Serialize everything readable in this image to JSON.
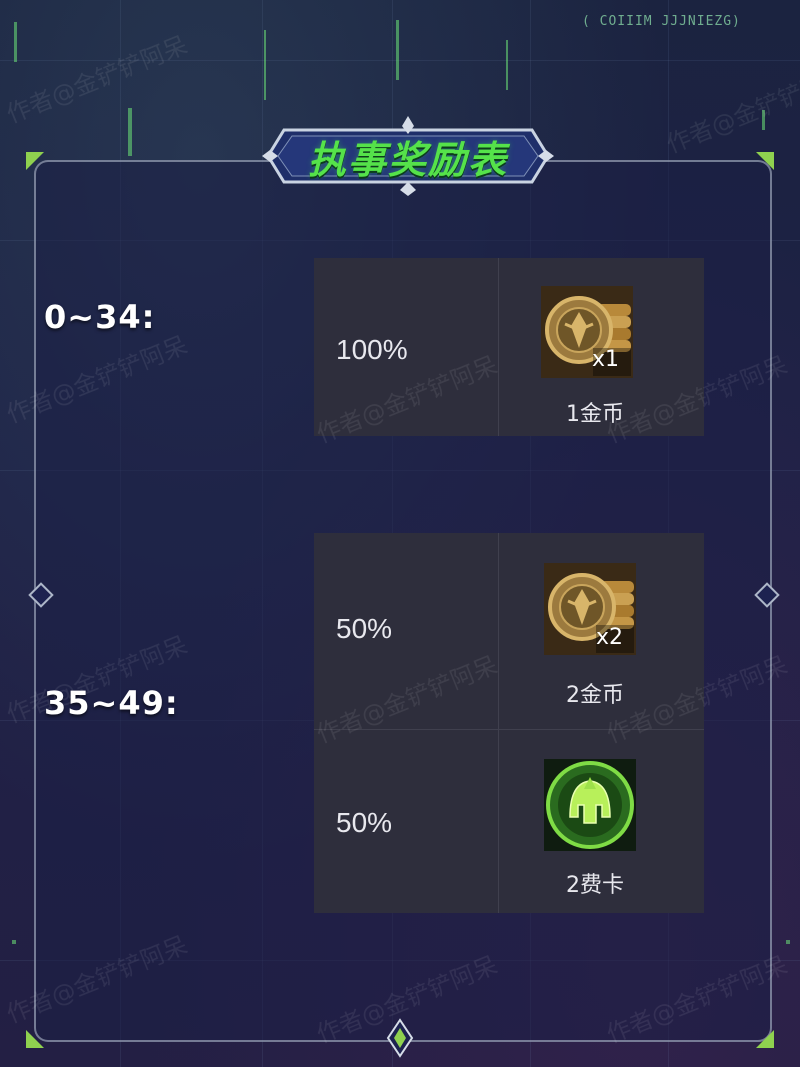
{
  "title": "执事奖励表",
  "top_code": "( COIIIM JJJNIEZG)",
  "watermark": "作者@金铲铲阿呆",
  "tiers": [
    {
      "range": "0~34:",
      "rows": [
        {
          "percent": "100%",
          "reward": "1金币",
          "qty": "x1",
          "icon": "gold-coin-icon"
        }
      ]
    },
    {
      "range": "35~49:",
      "rows": [
        {
          "percent": "50%",
          "reward": "2金币",
          "qty": "x2",
          "icon": "gold-coin-icon"
        },
        {
          "percent": "50%",
          "reward": "2费卡",
          "qty": "",
          "icon": "helmet-card-icon"
        }
      ]
    }
  ],
  "colors": {
    "title": "#55e24a",
    "accent": "#8fd14f",
    "table_bg": "#2e2e3c",
    "background": "#1e2146"
  }
}
